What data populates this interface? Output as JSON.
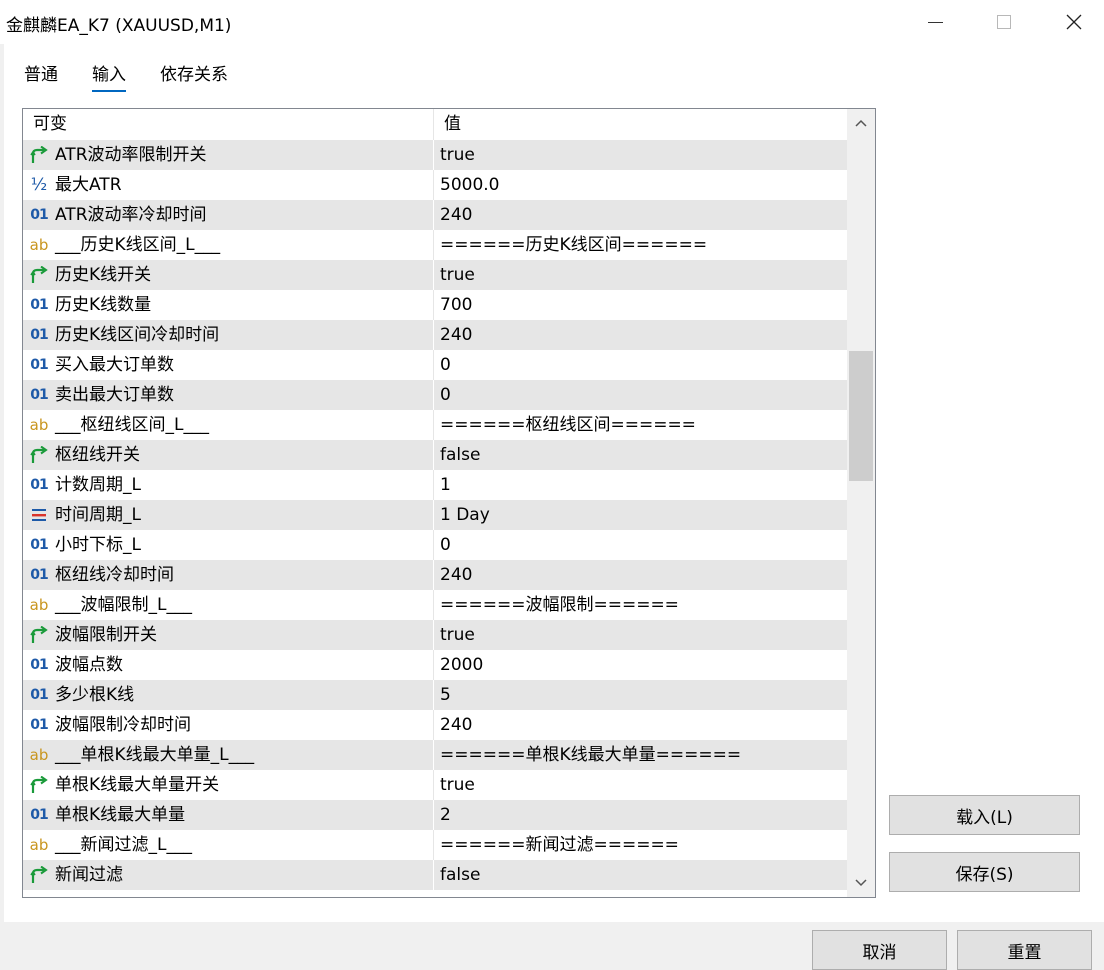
{
  "window": {
    "title": "金麒麟EA_K7 (XAUUSD,M1)"
  },
  "tabs": [
    {
      "label": "普通",
      "active": false
    },
    {
      "label": "输入",
      "active": true
    },
    {
      "label": "依存关系",
      "active": false
    }
  ],
  "grid": {
    "columns": {
      "name": "可变",
      "value": "值"
    },
    "rows": [
      {
        "type": "bool",
        "name": "ATR波动率限制开关",
        "value": "true"
      },
      {
        "type": "double",
        "name": "最大ATR",
        "value": "5000.0"
      },
      {
        "type": "int",
        "name": "ATR波动率冷却时间",
        "value": "240"
      },
      {
        "type": "string",
        "name": "___历史K线区间_L___",
        "value": "======历史K线区间======"
      },
      {
        "type": "bool",
        "name": "历史K线开关",
        "value": "true"
      },
      {
        "type": "int",
        "name": "历史K线数量",
        "value": "700"
      },
      {
        "type": "int",
        "name": "历史K线区间冷却时间",
        "value": "240"
      },
      {
        "type": "int",
        "name": "买入最大订单数",
        "value": "0"
      },
      {
        "type": "int",
        "name": "卖出最大订单数",
        "value": "0"
      },
      {
        "type": "string",
        "name": "___枢纽线区间_L___",
        "value": "======枢纽线区间======"
      },
      {
        "type": "bool",
        "name": "枢纽线开关",
        "value": "false"
      },
      {
        "type": "int",
        "name": "计数周期_L",
        "value": "1"
      },
      {
        "type": "enum",
        "name": "时间周期_L",
        "value": "1 Day"
      },
      {
        "type": "int",
        "name": "小时下标_L",
        "value": "0"
      },
      {
        "type": "int",
        "name": "枢纽线冷却时间",
        "value": "240"
      },
      {
        "type": "string",
        "name": "___波幅限制_L___",
        "value": "======波幅限制======"
      },
      {
        "type": "bool",
        "name": "波幅限制开关",
        "value": "true"
      },
      {
        "type": "int",
        "name": "波幅点数",
        "value": "2000"
      },
      {
        "type": "int",
        "name": "多少根K线",
        "value": "5"
      },
      {
        "type": "int",
        "name": "波幅限制冷却时间",
        "value": "240"
      },
      {
        "type": "string",
        "name": "___单根K线最大单量_L___",
        "value": "======单根K线最大单量======"
      },
      {
        "type": "bool",
        "name": "单根K线最大单量开关",
        "value": "true"
      },
      {
        "type": "int",
        "name": "单根K线最大单量",
        "value": "2"
      },
      {
        "type": "string",
        "name": "___新闻过滤_L___",
        "value": "======新闻过滤======"
      },
      {
        "type": "bool",
        "name": "新闻过滤",
        "value": "false"
      }
    ]
  },
  "type_icons": {
    "bool": "bool-arrow-icon",
    "double": "double-half-icon",
    "int": "int-01-icon",
    "string": "string-ab-icon",
    "enum": "enum-list-icon"
  },
  "icon_glyphs": {
    "double": "½",
    "int": "01",
    "string": "ab"
  },
  "colors": {
    "accent": "#0067c0",
    "bool_icon": "#1a9a3a",
    "int_icon": "#1e5aa8",
    "string_icon": "#c8951e",
    "enum_icon": "#d9342b",
    "row_alt": "#e6e6e6"
  },
  "buttons": {
    "load": "载入(L)",
    "save": "保存(S)",
    "cancel": "取消",
    "reset": "重置"
  }
}
